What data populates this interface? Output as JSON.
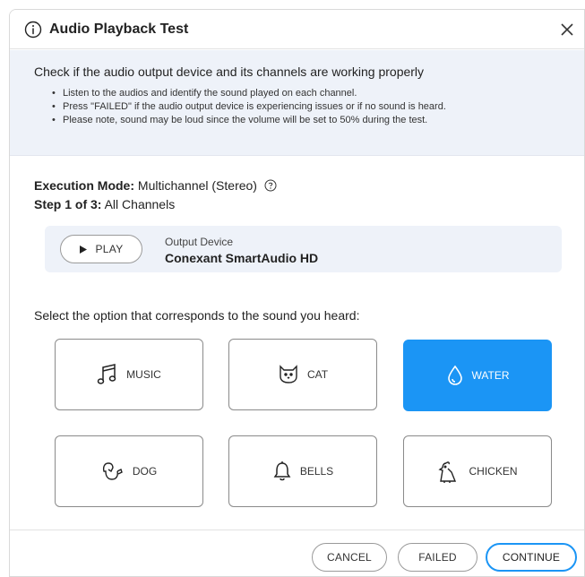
{
  "dialog": {
    "title": "Audio Playback Test",
    "icons": {
      "title_icon": "info-circle-icon",
      "close_icon": "close-icon"
    }
  },
  "instructions": {
    "heading": "Check if the audio output device and its channels are working properly",
    "items": [
      "Listen to the audios and identify the sound played on each channel.",
      "Press \"FAILED\" if the audio output device is experiencing issues or if no sound is heard.",
      "Please note, sound may be loud since the volume will be set to 50% during the test."
    ]
  },
  "execution": {
    "mode_label": "Execution Mode:",
    "mode_value": "Multichannel (Stereo)",
    "step_label": "Step 1 of 3:",
    "step_value": "All Channels"
  },
  "device": {
    "play_label": "PLAY",
    "output_label": "Output Device",
    "output_name": "Conexant SmartAudio HD"
  },
  "prompt": "Select the option that corresponds to the sound you heard:",
  "options": [
    {
      "label": "MUSIC",
      "icon": "music-note-icon",
      "selected": false
    },
    {
      "label": "CAT",
      "icon": "cat-icon",
      "selected": false
    },
    {
      "label": "WATER",
      "icon": "water-drop-icon",
      "selected": true
    },
    {
      "label": "DOG",
      "icon": "dog-icon",
      "selected": false
    },
    {
      "label": "BELLS",
      "icon": "bell-icon",
      "selected": false
    },
    {
      "label": "CHICKEN",
      "icon": "chicken-icon",
      "selected": false
    }
  ],
  "footer": {
    "cancel": "CANCEL",
    "failed": "FAILED",
    "continue": "CONTINUE"
  },
  "colors": {
    "accent": "#1b95f5",
    "panel_bg": "#eef2f9"
  }
}
